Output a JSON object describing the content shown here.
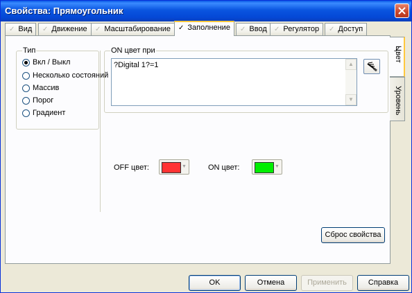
{
  "window": {
    "title": "Свойства: Прямоугольник"
  },
  "tabs": [
    {
      "label": "Вид",
      "active": false
    },
    {
      "label": "Движение",
      "active": false
    },
    {
      "label": "Масштабирование",
      "active": false
    },
    {
      "label": "Заполнение",
      "active": true
    },
    {
      "label": "Ввод",
      "active": false
    },
    {
      "label": "Регулятор",
      "active": false
    },
    {
      "label": "Доступ",
      "active": false
    }
  ],
  "side_tabs": [
    {
      "label": "Цвет",
      "active": true
    },
    {
      "label": "Уровень",
      "active": false
    }
  ],
  "type_group": {
    "label": "Тип",
    "options": [
      {
        "label": "Вкл / Выкл",
        "selected": true
      },
      {
        "label": "Несколько состояний",
        "selected": false
      },
      {
        "label": "Массив",
        "selected": false
      },
      {
        "label": "Порог",
        "selected": false
      },
      {
        "label": "Градиент",
        "selected": false
      }
    ]
  },
  "condition_group": {
    "label": "ON цвет при",
    "expression": "?Digital 1?=1"
  },
  "colors": {
    "off_label": "OFF цвет:",
    "off_color": "#ff3333",
    "on_label": "ON цвет:",
    "on_color": "#00ee00"
  },
  "reset_button": "Сброс свойства",
  "footer": {
    "ok": "OK",
    "cancel": "Отмена",
    "apply": "Применить",
    "help": "Справка"
  }
}
